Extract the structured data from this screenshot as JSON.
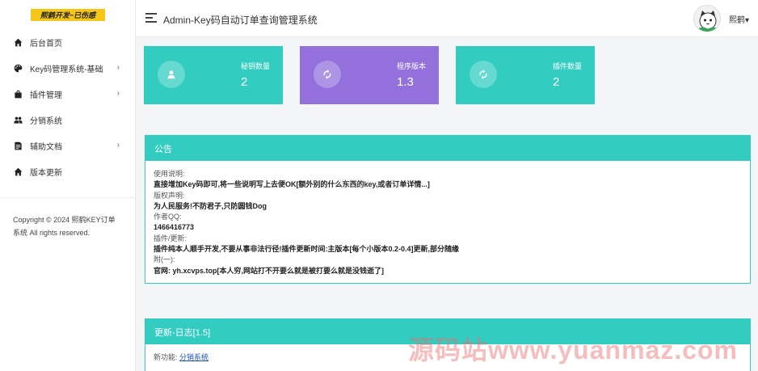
{
  "brand": {
    "logo_text": "熙鹤开发~已伤感"
  },
  "sidebar": {
    "items": [
      {
        "label": "后台首页",
        "icon": "home-icon",
        "has_submenu": false
      },
      {
        "label": "Key码管理系统-基础",
        "icon": "palette-icon",
        "has_submenu": true
      },
      {
        "label": "插件管理",
        "icon": "bag-icon",
        "has_submenu": true
      },
      {
        "label": "分销系统",
        "icon": "users-icon",
        "has_submenu": false
      },
      {
        "label": "辅助文档",
        "icon": "document-icon",
        "has_submenu": true
      },
      {
        "label": "版本更新",
        "icon": "home-icon",
        "has_submenu": false
      }
    ],
    "chevron": "›",
    "copyright_line1": "Copyright © 2024 熙鹤KEY订单",
    "copyright_line2": "系统 All rights reserved."
  },
  "header": {
    "title": "Admin-Key码自动订单查询管理系统",
    "username": "熙鹤▾"
  },
  "stats": [
    {
      "label": "秘钥数量",
      "value": "2",
      "color": "#33ccc0",
      "icon": "user-icon"
    },
    {
      "label": "程序版本",
      "value": "1.3",
      "color": "#9370db",
      "icon": "refresh-icon"
    },
    {
      "label": "插件数量",
      "value": "2",
      "color": "#33ccc0",
      "icon": "refresh-icon"
    }
  ],
  "announcement": {
    "title": "公告",
    "lines": [
      {
        "text": "使用说明:",
        "bold": false
      },
      {
        "text": "直接增加Key码即可,将一些说明写上去便OK[额外别的什么东西的key,或者订单详情...]",
        "bold": true
      },
      {
        "text": "版权声明:",
        "bold": false
      },
      {
        "text": "为人民服务!不防君子,只防圆钱Dog",
        "bold": true
      },
      {
        "text": "作者QQ:",
        "bold": false
      },
      {
        "text": "1466416773",
        "bold": true
      },
      {
        "text": "插件/更新:",
        "bold": false
      },
      {
        "text": "插件纯本人顺手开发,不要从事非法行径!插件更新时间:主版本[每个小版本0.2-0.4]更新,部分随缘",
        "bold": true
      },
      {
        "text": "附(一):",
        "bold": false
      },
      {
        "text": "官网: yh.xcvps.top[本人穷,网站打不开要么就是被打要么就是没钱逝了]",
        "bold": true
      }
    ]
  },
  "changelog": {
    "title": "更新-日志[1.5]",
    "feature_label": "新功能: ",
    "feature_link": "分销系统"
  },
  "watermark": {
    "text": "源码站www.yuanmaz.com",
    "faint": "源码站 www"
  }
}
